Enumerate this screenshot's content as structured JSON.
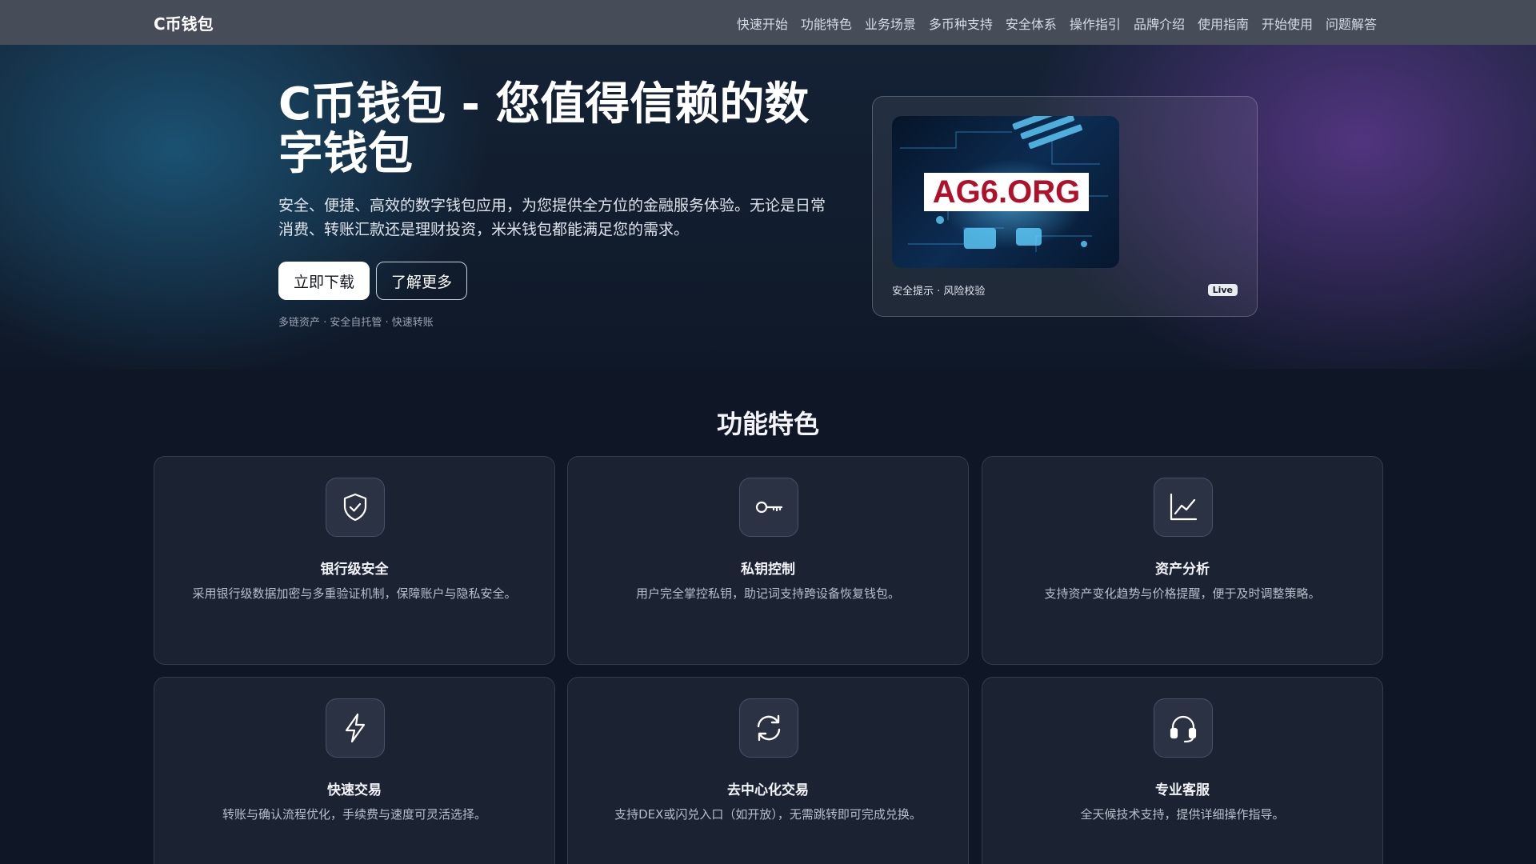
{
  "nav": {
    "brand": "C币钱包",
    "links": [
      "快速开始",
      "功能特色",
      "业务场景",
      "多币种支持",
      "安全体系",
      "操作指引",
      "品牌介绍",
      "使用指南",
      "开始使用",
      "问题解答"
    ]
  },
  "hero": {
    "title": "C币钱包 - 您值得信赖的数字钱包",
    "description": "安全、便捷、高效的数字钱包应用，为您提供全方位的金融服务体验。无论是日常消费、转账汇款还是理财投资，米米钱包都能满足您的需求。",
    "primary_button": "立即下载",
    "secondary_button": "了解更多",
    "tags": "多链资产 · 安全自托管 · 快速转账",
    "card": {
      "image_label": "AG6.ORG",
      "caption": "安全提示 · 风险校验",
      "badge": "Live"
    }
  },
  "features": {
    "title": "功能特色",
    "items": [
      {
        "icon": "shield-check-icon",
        "name": "银行级安全",
        "desc": "采用银行级数据加密与多重验证机制，保障账户与隐私安全。"
      },
      {
        "icon": "key-icon",
        "name": "私钥控制",
        "desc": "用户完全掌控私钥，助记词支持跨设备恢复钱包。"
      },
      {
        "icon": "line-chart-icon",
        "name": "资产分析",
        "desc": "支持资产变化趋势与价格提醒，便于及时调整策略。"
      },
      {
        "icon": "lightning-icon",
        "name": "快速交易",
        "desc": "转账与确认流程优化，手续费与速度可灵活选择。"
      },
      {
        "icon": "swap-arrows-icon",
        "name": "去中心化交易",
        "desc": "支持DEX或闪兑入口（如开放），无需跳转即可完成兑换。"
      },
      {
        "icon": "headset-icon",
        "name": "专业客服",
        "desc": "全天候技术支持，提供详细操作指导。"
      }
    ]
  }
}
